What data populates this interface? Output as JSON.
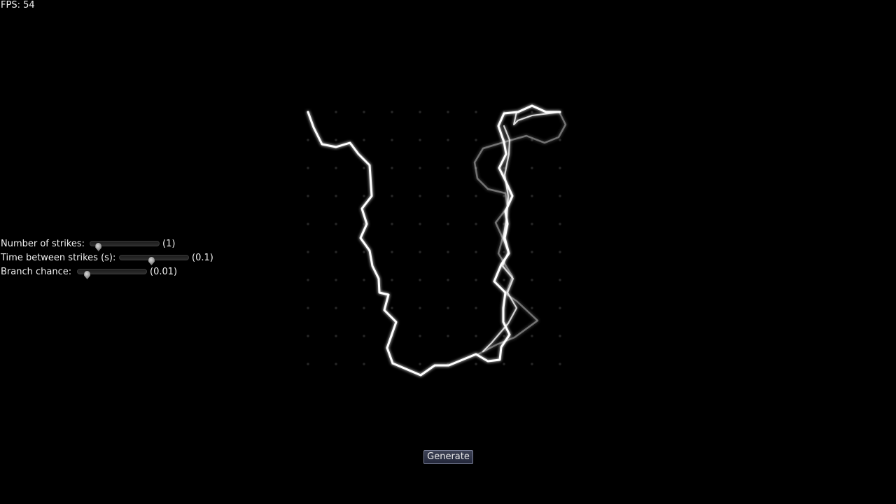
{
  "hud": {
    "fps": "FPS: 54"
  },
  "controls": [
    {
      "name": "strikes",
      "label": "Number of strikes:",
      "value": "(1)",
      "fraction": 0.08
    },
    {
      "name": "time",
      "label": "Time between strikes (s):",
      "value": "(0.1)",
      "fraction": 0.45
    },
    {
      "name": "branch",
      "label": "Branch chance:",
      "value": "(0.01)",
      "fraction": 0.1
    }
  ],
  "generate_button": {
    "label": "Generate"
  },
  "colors": {
    "background": "#000000",
    "bolt": "#ffffff",
    "grid_dot": "#262626",
    "button_border": "#7a7f96"
  }
}
